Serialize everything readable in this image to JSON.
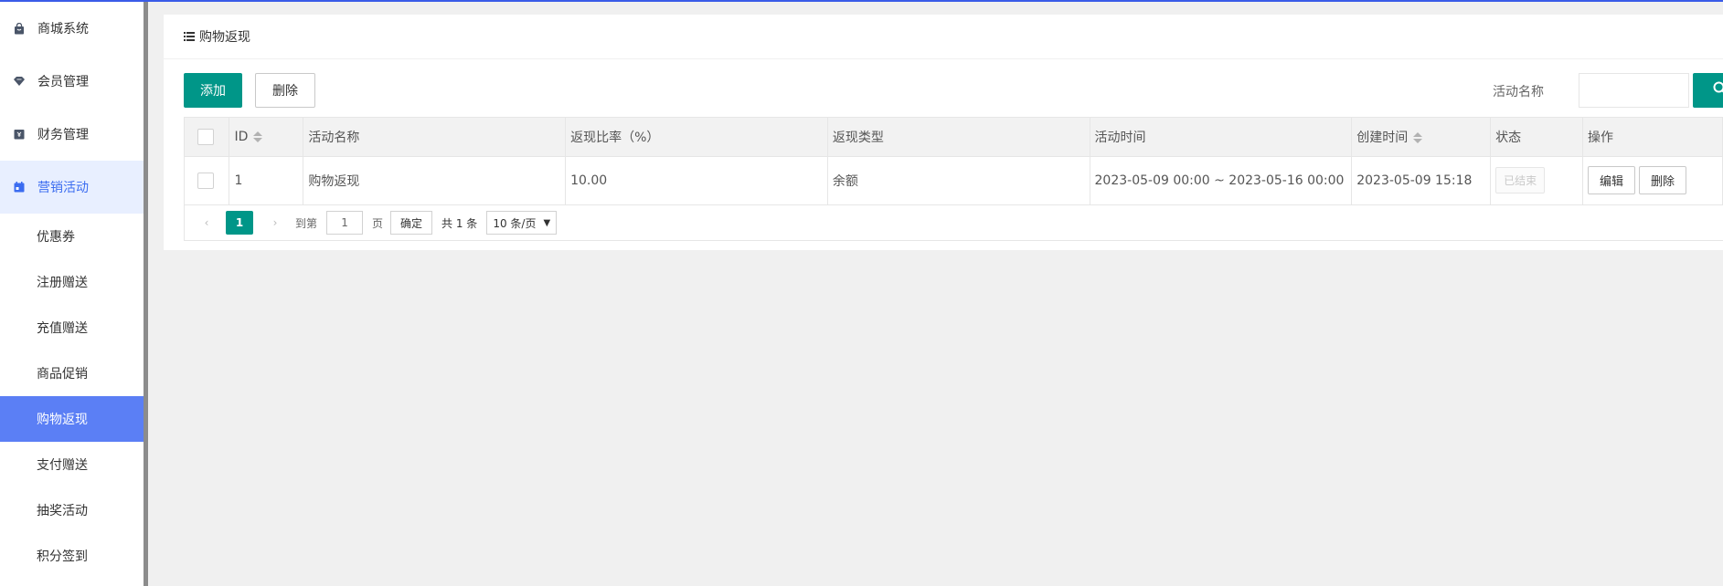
{
  "sidebar": {
    "menus": [
      {
        "label": "商城系统",
        "icon": "bag-icon"
      },
      {
        "label": "会员管理",
        "icon": "diamond-icon"
      },
      {
        "label": "财务管理",
        "icon": "wallet-icon"
      },
      {
        "label": "营销活动",
        "icon": "calendar-icon"
      }
    ],
    "sub_items": [
      "优惠券",
      "注册赠送",
      "充值赠送",
      "商品促销",
      "购物返现",
      "支付赠送",
      "抽奖活动",
      "积分签到"
    ],
    "active_sub": "购物返现"
  },
  "panel": {
    "title": "购物返现",
    "add_label": "添加",
    "delete_label": "删除",
    "search_label": "活动名称",
    "search_value": ""
  },
  "table": {
    "headers": [
      "ID",
      "活动名称",
      "返现比率（%）",
      "返现类型",
      "活动时间",
      "创建时间",
      "状态",
      "操作"
    ],
    "rows": [
      {
        "id": "1",
        "name": "购物返现",
        "rate": "10.00",
        "type": "余额",
        "time": "2023-05-09 00:00 ~ 2023-05-16 00:00",
        "created": "2023-05-09 15:18",
        "status": "已结束",
        "edit_label": "编辑",
        "delete_label": "删除"
      }
    ]
  },
  "pager": {
    "current_page": "1",
    "goto_label": "到第",
    "goto_value": "1",
    "page_unit": "页",
    "confirm_label": "确定",
    "total_text": "共 1 条",
    "page_size": "10 条/页"
  },
  "colors": {
    "accent": "#009688",
    "sidebar_active": "#5b7ff5",
    "sidebar_open_bg": "#e8efff",
    "top_bar": "#3a5ce8"
  }
}
